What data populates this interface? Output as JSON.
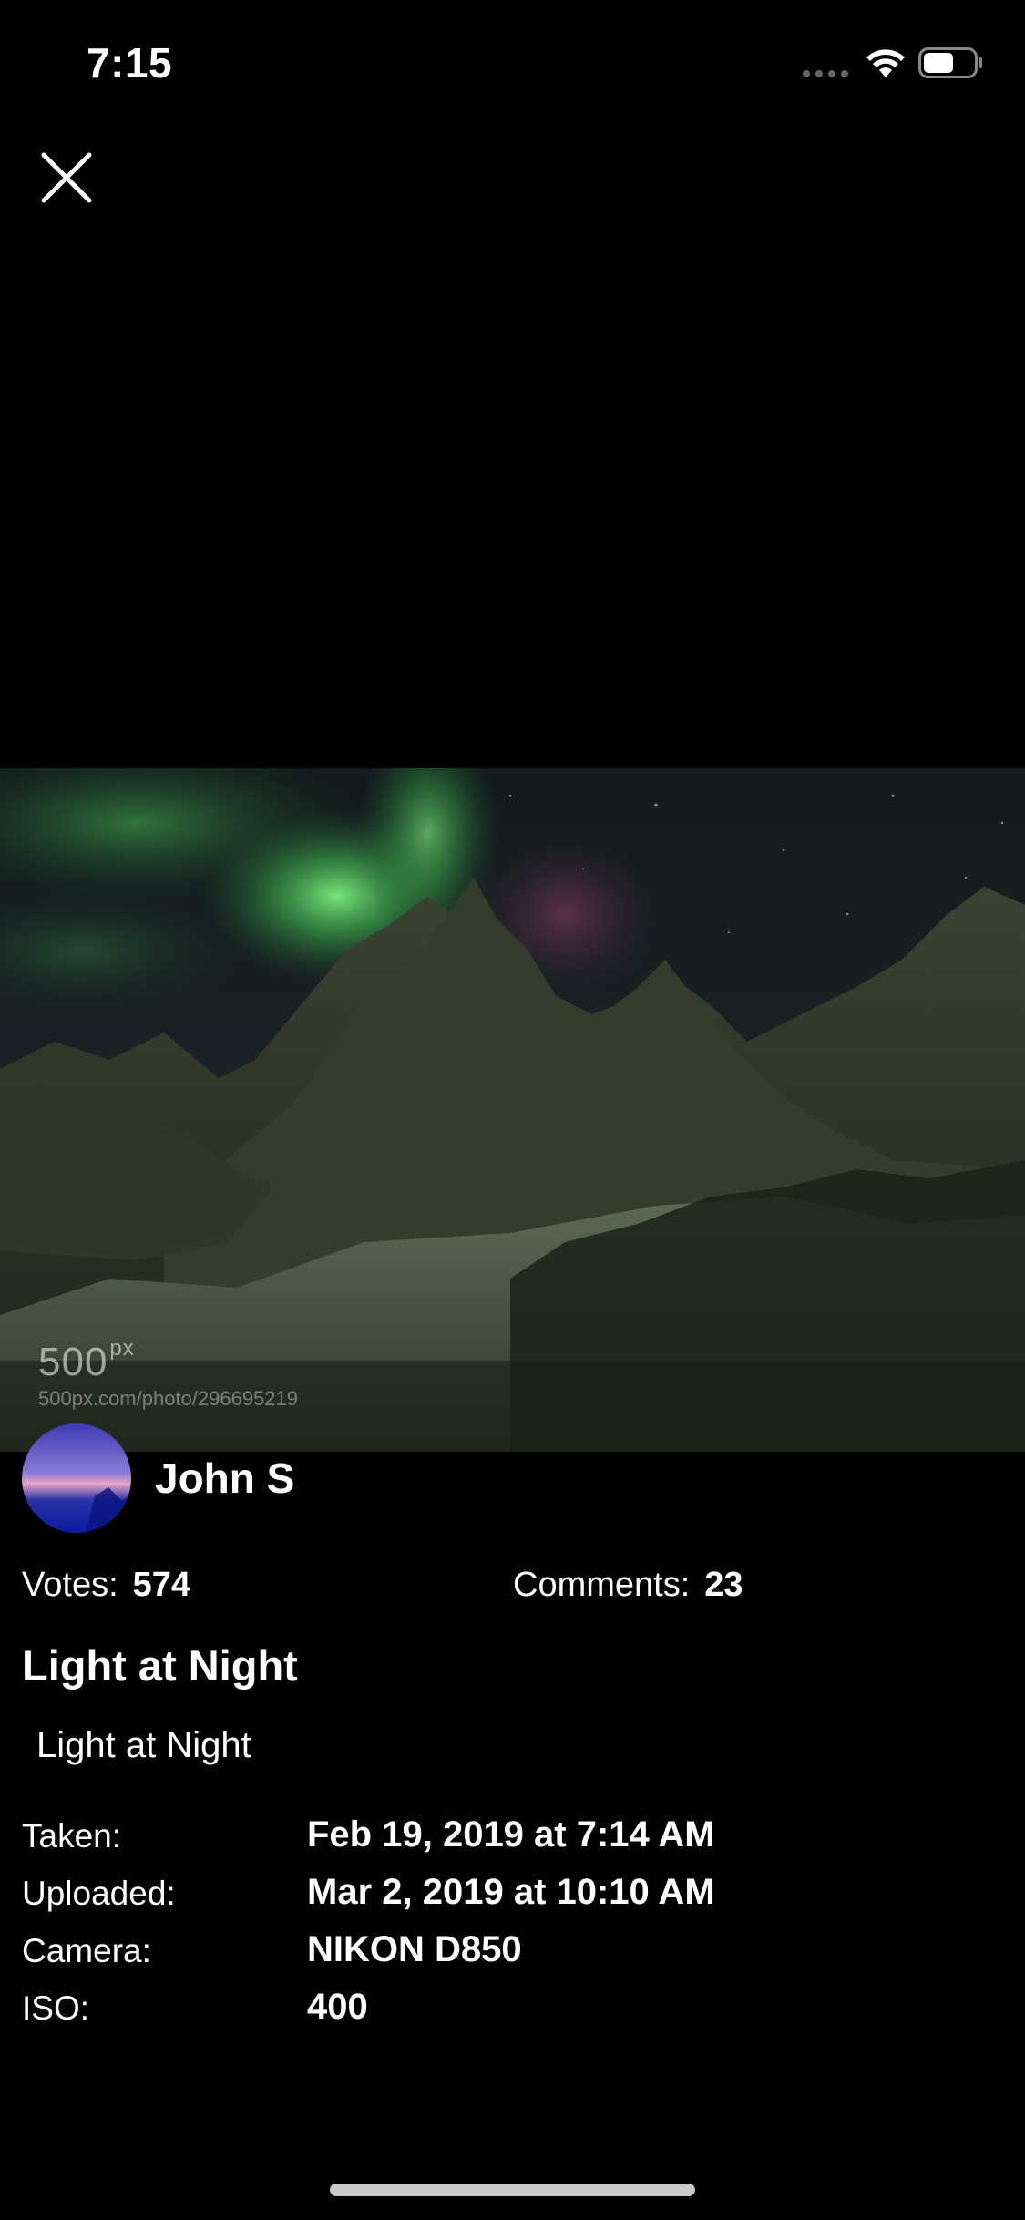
{
  "status_bar": {
    "time": "7:15"
  },
  "toolbar": {
    "close_icon": "close-icon"
  },
  "photo": {
    "subject": "aurora-over-mountains",
    "watermark_logo": "500",
    "watermark_logo_sup": "px",
    "watermark_url": "500px.com/photo/296695219"
  },
  "author": {
    "name": "John S"
  },
  "stats": {
    "votes_label": "Votes:",
    "votes_value": "574",
    "comments_label": "Comments:",
    "comments_value": "23"
  },
  "title": "Light at Night",
  "description": "Light at Night",
  "details": {
    "taken_label": "Taken:",
    "taken_value": "Feb 19, 2019 at 7:14 AM",
    "uploaded_label": "Uploaded:",
    "uploaded_value": "Mar 2, 2019 at 10:10 AM",
    "camera_label": "Camera:",
    "camera_value": "NIKON D850",
    "iso_label": "ISO:",
    "iso_value": "400"
  },
  "colors": {
    "background": "#000000",
    "text": "#ffffff",
    "aurora_green": "#5ddc6a"
  }
}
